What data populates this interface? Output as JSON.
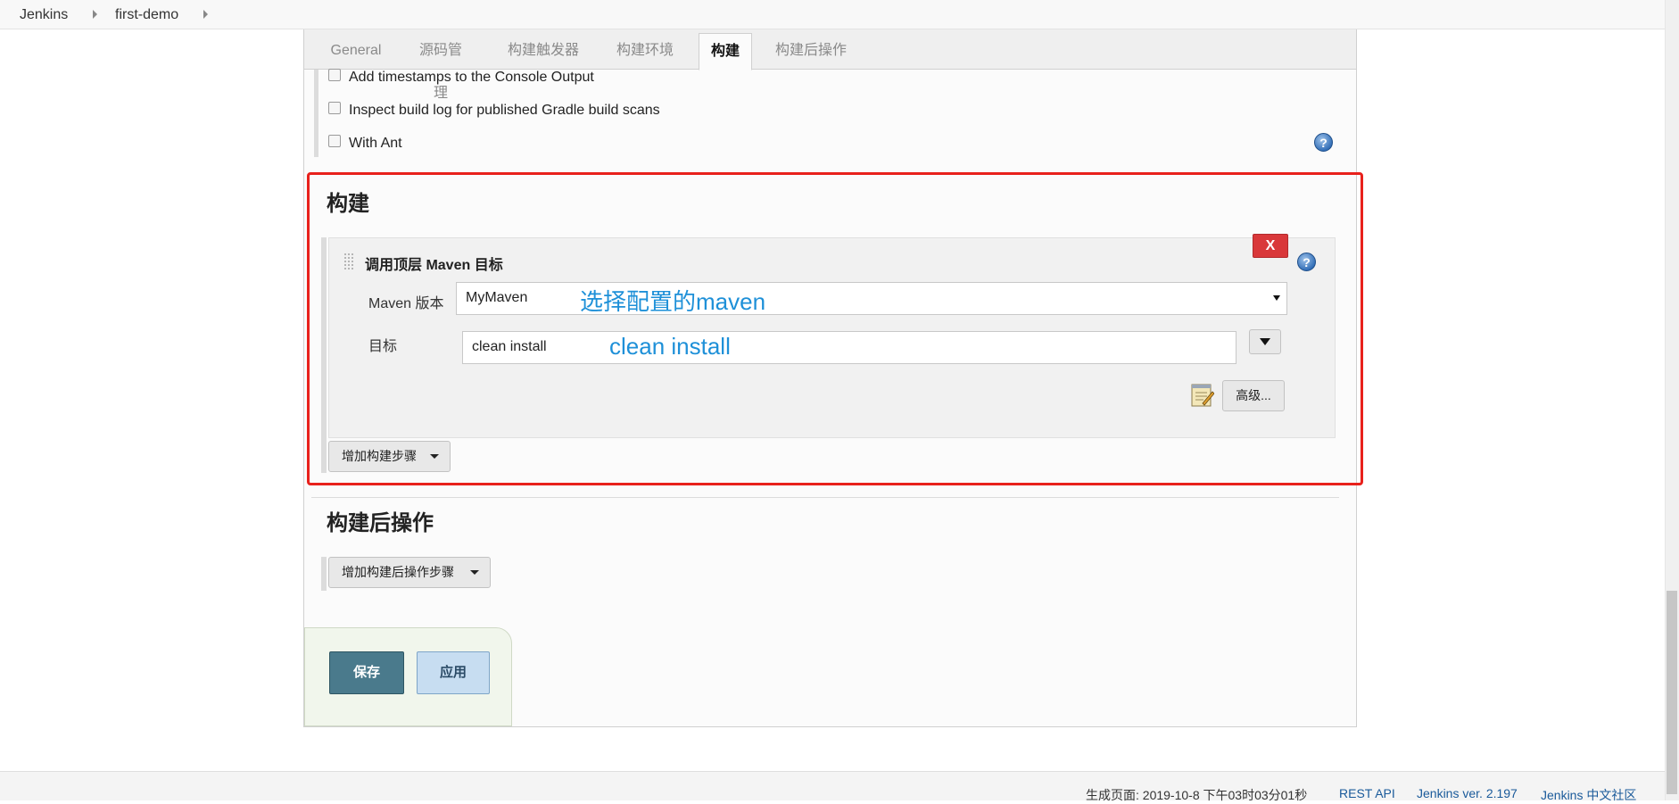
{
  "breadcrumb": {
    "items": [
      "Jenkins",
      "first-demo"
    ]
  },
  "tabs": [
    {
      "label": "General",
      "active": false
    },
    {
      "label": "源码管理",
      "active": false
    },
    {
      "label": "构建触发器",
      "active": false
    },
    {
      "label": "构建环境",
      "active": false
    },
    {
      "label": "构建",
      "active": true
    },
    {
      "label": "构建后操作",
      "active": false
    }
  ],
  "build_env": {
    "options": [
      {
        "label": "Add timestamps to the Console Output",
        "checked": false
      },
      {
        "label": "Inspect build log for published Gradle build scans",
        "checked": false
      },
      {
        "label": "With Ant",
        "checked": false
      }
    ]
  },
  "build": {
    "title": "构建",
    "step": {
      "title": "调用顶层 Maven 目标",
      "delete_label": "X",
      "maven_version_label": "Maven 版本",
      "maven_version_value": "MyMaven",
      "goals_label": "目标",
      "goals_value": "clean install",
      "advanced_label": "高级..."
    },
    "add_step_label": "增加构建步骤"
  },
  "annotations": {
    "maven_note": "选择配置的maven",
    "goals_note": "clean install",
    "highlight_color": "#e8211c"
  },
  "post_build": {
    "title": "构建后操作",
    "add_step_label": "增加构建后操作步骤"
  },
  "actions": {
    "save_label": "保存",
    "apply_label": "应用"
  },
  "footer": {
    "generated": "生成页面: 2019-10-8 下午03时03分01秒",
    "rest_api": "REST API",
    "version": "Jenkins ver. 2.197",
    "community": "Jenkins 中文社区"
  },
  "icons": {
    "help": "help-icon",
    "dropdown": "chevron-down-icon",
    "advanced": "notepad-icon"
  },
  "colors": {
    "save_button": "#4a7a8c",
    "apply_button": "#c7ddf1",
    "delete_button": "#d9383a",
    "note_text": "#1e90d8"
  }
}
